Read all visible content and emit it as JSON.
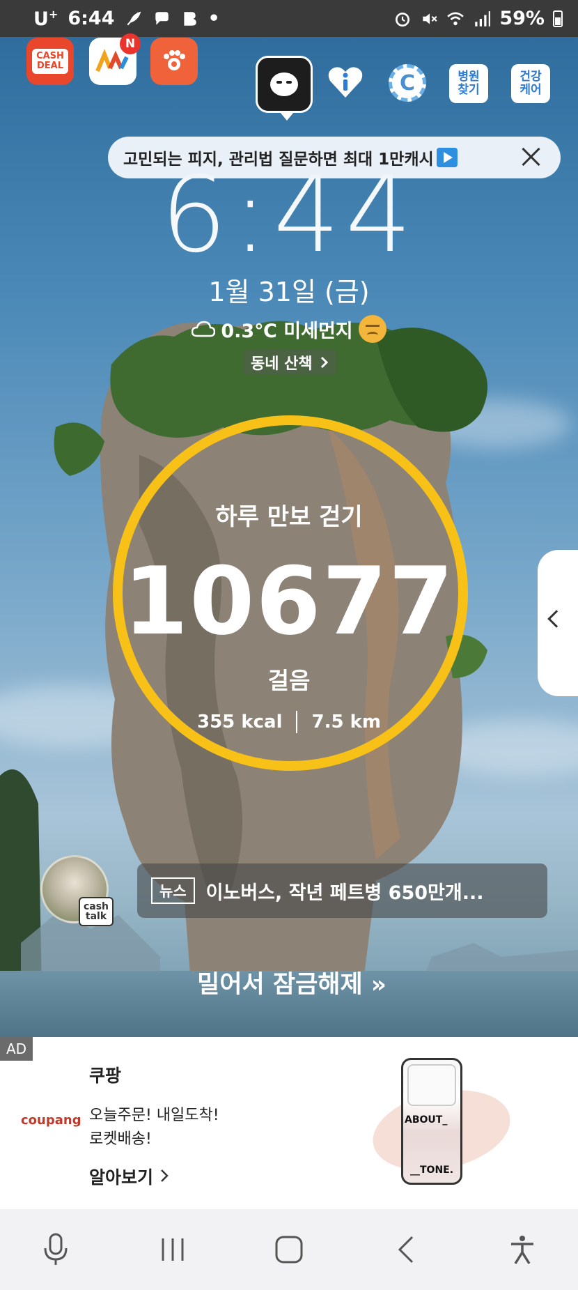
{
  "status_bar": {
    "carrier": "U",
    "carrier_sup": "+",
    "time": "6:44",
    "dot": "•",
    "battery": "59%"
  },
  "apps": {
    "cashdeal_line1": "CASH",
    "cashdeal_line2": "DEAL",
    "badge": "N",
    "coin_letter": "C",
    "hospital_line1": "병원",
    "hospital_line2": "찾기",
    "health_line1": "건강",
    "health_line2": "케어"
  },
  "promo": {
    "text": "고민되는 피지, 관리법 질문하면 최대 1만캐시"
  },
  "lock": {
    "clock": "6:44",
    "date": "1월 31일 (금)",
    "temperature": "0.3℃ 미세먼지",
    "walk_link": "동네 산책"
  },
  "steps": {
    "title": "하루 만보 걷기",
    "count": "10677",
    "unit": "걸음",
    "kcal": "355 kcal",
    "distance": "7.5 km"
  },
  "talk": {
    "line1": "cash",
    "line2": "talk"
  },
  "news": {
    "tag": "뉴스",
    "headline": "이노버스, 작년 페트병 650만개..."
  },
  "unlock": {
    "text": "밀어서 잠금해제",
    "arrows": "»"
  },
  "ad": {
    "label": "AD",
    "logo": "coupang",
    "brand": "쿠팡",
    "line1": "오늘주문! 내일도착!",
    "line2": "로켓배송!",
    "more": "알아보기",
    "product_text1": "ABOUT_",
    "product_text2": "__TONE."
  },
  "colors": {
    "ring": "#f7c118",
    "status_bar": "#3a3a3a",
    "navbar": "#f2f2f4"
  }
}
